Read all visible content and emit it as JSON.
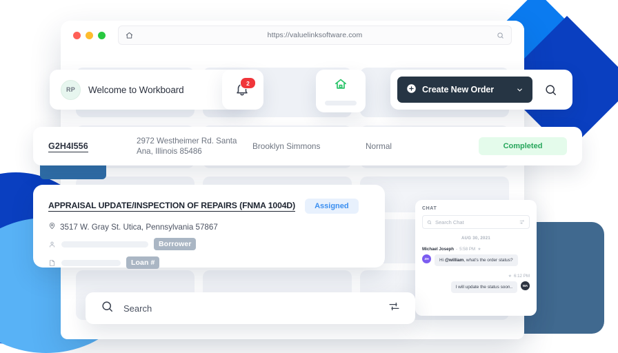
{
  "browser": {
    "url": "https://valuelinksoftware.com",
    "home_icon": "home-icon",
    "search_icon": "search-icon",
    "traffic_lights": [
      "close-red",
      "minimize-yellow",
      "maximize-green"
    ]
  },
  "header": {
    "avatar_initials": "RP",
    "welcome_text": "Welcome to Workboard",
    "notification_count": "2",
    "bell_icon": "bell-icon",
    "house_icon": "house-icon",
    "create_order_label": "Create New Order",
    "create_order_icon": "plus-circle-icon",
    "create_order_chevron": "chevron-down-icon",
    "search_icon": "search-icon"
  },
  "order_row": {
    "id": "G2H4I556",
    "address": "2972 Westheimer Rd. Santa Ana, Illinois 85486",
    "client": "Brooklyn Simmons",
    "priority": "Normal",
    "status": "Completed"
  },
  "appraisal": {
    "title": "APPRAISAL UPDATE/INSPECTION OF REPAIRS (FNMA 1004D)",
    "status": "Assigned",
    "address": "3517 W. Gray St. Utica, Pennsylvania 57867",
    "pin_icon": "map-pin-icon",
    "borrower_icon": "person-icon",
    "borrower_tag": "Borrower",
    "loan_icon": "document-icon",
    "loan_tag": "Loan #"
  },
  "chat": {
    "title": "CHAT",
    "search_placeholder": "Search Chat",
    "search_icon": "search-icon",
    "filter_icon": "filter-icon",
    "date_divider": "AUG 30, 2021",
    "messages": [
      {
        "sender": "Michael Joseph",
        "time": "5:58 PM",
        "avatar": "ZH",
        "text_prefix": "Hi ",
        "mention": "@william",
        "text_suffix": ", what's the order status?"
      },
      {
        "sender": "",
        "time": "6:12 PM",
        "avatar": "WA",
        "text": "I will update the status soon.."
      }
    ]
  },
  "bottom_search": {
    "placeholder": "Search",
    "search_icon": "search-icon",
    "filter_icon": "filter-sliders-icon"
  },
  "colors": {
    "accent_dark": "#263544",
    "blue_bright": "#0b7bf0",
    "blue_deep": "#0a3fc0",
    "blue_light": "#58b2f6",
    "slate": "#40698f",
    "green": "#26a65b",
    "red_badge": "#f0353a",
    "purple_avatar": "#7b5cf0"
  }
}
